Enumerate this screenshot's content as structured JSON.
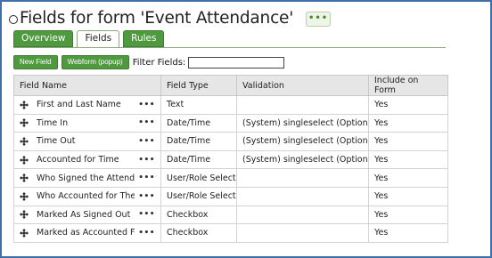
{
  "header": {
    "title": "Fields for form 'Event Attendance'",
    "more_label": "•••"
  },
  "tabs": [
    {
      "label": "Overview",
      "active": false
    },
    {
      "label": "Fields",
      "active": true
    },
    {
      "label": "Rules",
      "active": false
    }
  ],
  "toolbar": {
    "new_field_label": "New Field",
    "webform_label": "Webform (popup)",
    "filter_label": "Filter Fields:",
    "filter_value": ""
  },
  "table": {
    "columns": [
      "Field Name",
      "Field Type",
      "Validation",
      "Include on Form"
    ],
    "row_menu_label": "•••",
    "rows": [
      {
        "name": "First and Last Name",
        "type": "Text",
        "validation": "",
        "include": "Yes"
      },
      {
        "name": "Time In",
        "type": "Date/Time",
        "validation": "(System) singleselect (Optional)",
        "include": "Yes"
      },
      {
        "name": "Time Out",
        "type": "Date/Time",
        "validation": "(System) singleselect (Optional)",
        "include": "Yes"
      },
      {
        "name": "Accounted for Time",
        "type": "Date/Time",
        "validation": "(System) singleselect (Optional)",
        "include": "Yes"
      },
      {
        "name": "Who Signed the Attendee Out",
        "type": "User/Role Select",
        "validation": "",
        "include": "Yes"
      },
      {
        "name": "Who Accounted for Them",
        "type": "User/Role Select",
        "validation": "",
        "include": "Yes"
      },
      {
        "name": "Marked As Signed Out",
        "type": "Checkbox",
        "validation": "",
        "include": "Yes"
      },
      {
        "name": "Marked as Accounted For",
        "type": "Checkbox",
        "validation": "",
        "include": "Yes"
      }
    ]
  },
  "colors": {
    "tab_green": "#4f9a3f",
    "frame_blue": "#3d6fa8",
    "header_gray": "#e6e6e6"
  }
}
